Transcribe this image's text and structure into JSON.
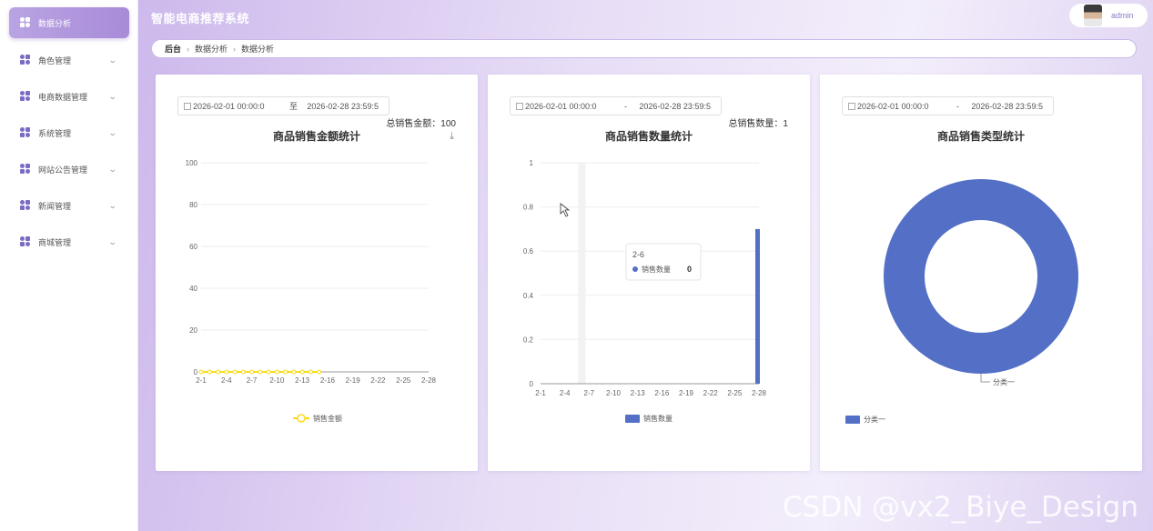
{
  "app": {
    "title": "智能电商推荐系统",
    "user": "admin"
  },
  "sidebar": {
    "items": [
      {
        "label": "数据分析",
        "active": true
      },
      {
        "label": "角色管理"
      },
      {
        "label": "电商数据管理"
      },
      {
        "label": "系统管理"
      },
      {
        "label": "网站公告管理"
      },
      {
        "label": "新闻管理"
      },
      {
        "label": "商城管理"
      }
    ]
  },
  "breadcrumb": [
    "后台",
    "数据分析",
    "数据分析"
  ],
  "cards": [
    {
      "start": "2026-02-01 00:00:0",
      "sep": "至",
      "end": "2026-02-28 23:59:5",
      "total": "总销售金额：100",
      "title": "商品销售金额统计"
    },
    {
      "start": "2026-02-01 00:00:0",
      "sep": "-",
      "end": "2026-02-28 23:59:5",
      "total": "总销售数量：1",
      "title": "商品销售数量统计"
    },
    {
      "start": "2026-02-01 00:00:0",
      "sep": "-",
      "end": "2026-02-28 23:59:5",
      "total": "",
      "title": "商品销售类型统计"
    }
  ],
  "tooltip": {
    "title": "2-6",
    "series": "销售数量",
    "value": "0"
  },
  "watermark": "CSDN @vx2_Biye_Design",
  "colors": {
    "line": "#fadb14",
    "bar": "#5470c6",
    "pie": "#5470c6",
    "accent": "#a88bd8"
  },
  "chart_data": [
    {
      "type": "line",
      "title": "商品销售金额统计",
      "x": [
        "2-1",
        "2-2",
        "2-3",
        "2-4",
        "2-5",
        "2-6",
        "2-7",
        "2-8",
        "2-9",
        "2-10",
        "2-11",
        "2-12",
        "2-13",
        "2-14",
        "2-15"
      ],
      "x_ticks": [
        "2-1",
        "2-4",
        "2-7",
        "2-10",
        "2-13",
        "2-16",
        "2-19",
        "2-22",
        "2-25",
        "2-28"
      ],
      "series": [
        {
          "name": "销售金额",
          "values": [
            0,
            0,
            0,
            0,
            0,
            0,
            0,
            0,
            0,
            0,
            0,
            0,
            0,
            0,
            0
          ]
        }
      ],
      "ylim": [
        0,
        100
      ],
      "y_ticks": [
        0,
        20,
        40,
        60,
        80,
        100
      ],
      "legend": "bottom"
    },
    {
      "type": "bar",
      "title": "商品销售数量统计",
      "x_ticks": [
        "2-1",
        "2-4",
        "2-7",
        "2-10",
        "2-13",
        "2-16",
        "2-19",
        "2-22",
        "2-25",
        "2-28"
      ],
      "categories": [
        "2-28"
      ],
      "series": [
        {
          "name": "销售数量",
          "values": [
            0.7
          ]
        }
      ],
      "ylim": [
        0,
        1
      ],
      "y_ticks": [
        0,
        0.2,
        0.4,
        0.6,
        0.8,
        1
      ],
      "legend": "bottom"
    },
    {
      "type": "pie",
      "title": "商品销售类型统计",
      "slices": [
        {
          "label": "分类一",
          "value": 1
        }
      ],
      "legend": "bottom-left"
    }
  ]
}
